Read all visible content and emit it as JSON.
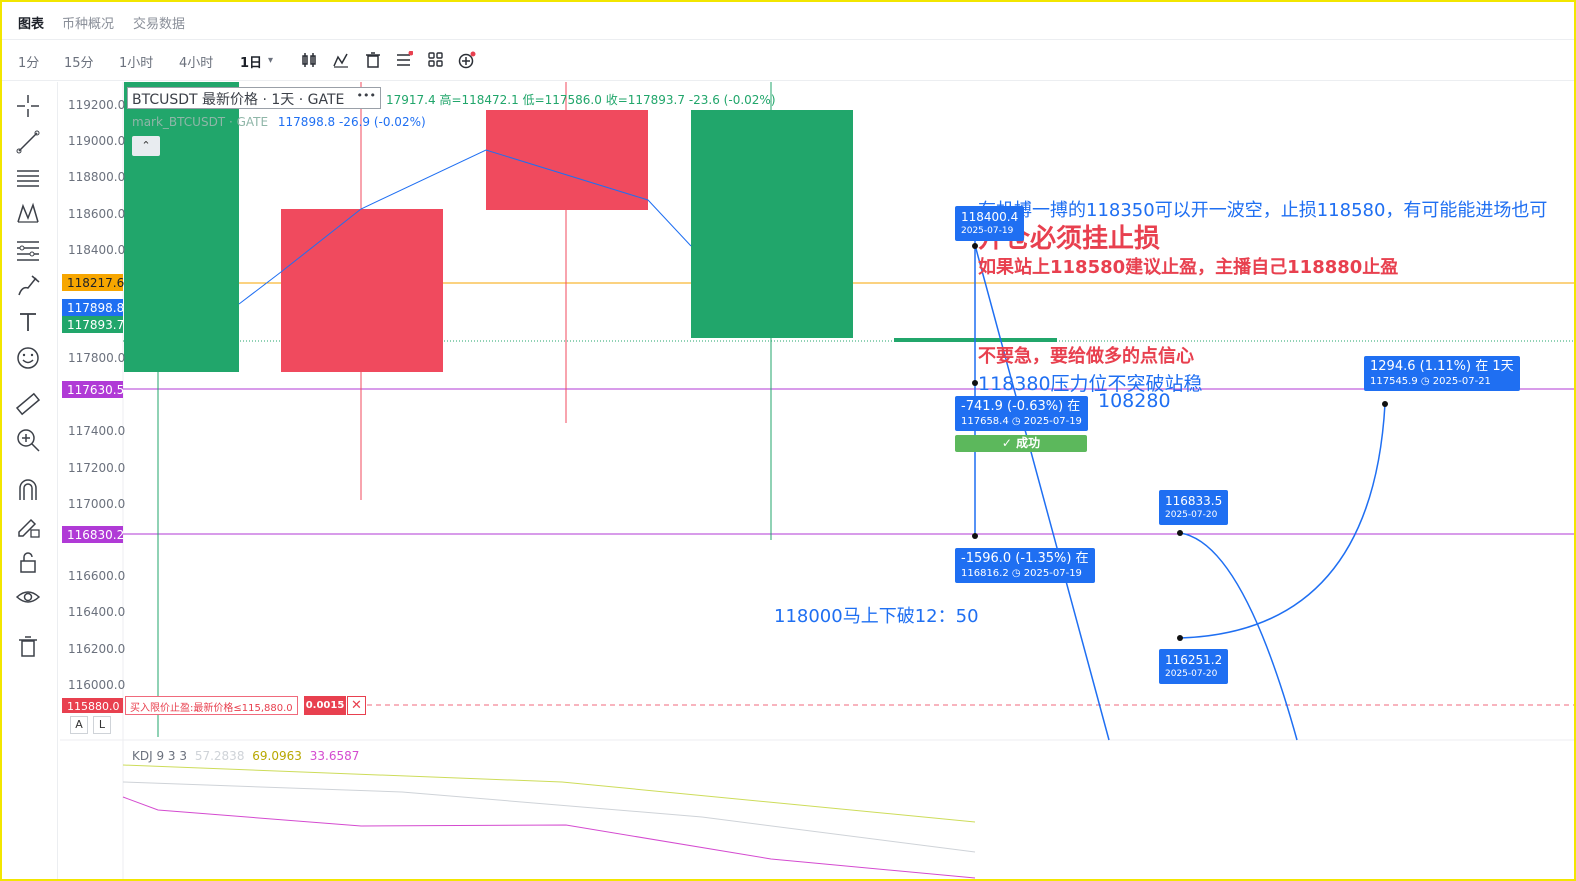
{
  "tabs": [
    {
      "label": "图表",
      "active": true
    },
    {
      "label": "币种概况",
      "active": false
    },
    {
      "label": "交易数据",
      "active": false
    }
  ],
  "timeframes": [
    {
      "label": "1分",
      "active": false
    },
    {
      "label": "15分",
      "active": false
    },
    {
      "label": "1小时",
      "active": false
    },
    {
      "label": "4小时",
      "active": false
    },
    {
      "label": "1日",
      "active": true
    }
  ],
  "timeframe_dropdown_icon": "▾",
  "toolbar_icons": [
    "candle-type-icon",
    "indicator-icon",
    "delete-icon",
    "list-icon",
    "grid-icon",
    "add-icon"
  ],
  "sidebar_icons": [
    "crosshair-icon",
    "trend-line-icon",
    "horizontal-lines-icon",
    "pattern-icon",
    "fib-icon",
    "brush-icon",
    "text-icon",
    "emoji-icon",
    "ruler-icon",
    "zoom-in-icon",
    "magnet-icon",
    "lock-drawing-icon",
    "lock-icon",
    "eye-icon",
    "trash-icon"
  ],
  "legend": {
    "title": "BTCUSDT 最新价格 · 1天 · GATE",
    "more": "•••",
    "values": "17917.4  高=118472.1  低=117586.0  收=117893.7  -23.6 (-0.02%)",
    "mark_label": "mark_BTCUSDT · GATE",
    "mark_values": "117898.8  -26.9 (-0.02%)",
    "collapse": "⌃"
  },
  "price_axis": {
    "ticks": [
      "119200.0",
      "119000.0",
      "118800.0",
      "118600.0",
      "118400.0",
      "117800.0",
      "117400.0",
      "117200.0",
      "117000.0",
      "116600.0",
      "116400.0",
      "116200.0",
      "116000.0"
    ],
    "highlighted": [
      {
        "text": "118217.6",
        "color": "#f7a600",
        "text_color": "#1d2129"
      },
      {
        "text": "117898.8",
        "color": "#1f6ff2",
        "text_color": "#ffffff"
      },
      {
        "text": "117893.7",
        "color": "#21a66b",
        "text_color": "#ffffff"
      },
      {
        "text": "117630.5",
        "color": "#b03ad6",
        "text_color": "#ffffff"
      },
      {
        "text": "116830.2",
        "color": "#b03ad6",
        "text_color": "#ffffff"
      },
      {
        "text": "115880.0",
        "color": "#e8404f",
        "text_color": "#ffffff"
      }
    ]
  },
  "annotations": {
    "line1": "有机搏一搏的118350可以开一波空，止损118580，有可能能进场也可",
    "line2": "开仓必须挂止损",
    "line3": "如果站上118580建议止盈，主播自己118880止盈",
    "line4": "不要急，要给做多的点信心",
    "line5": "118380压力位不突破站稳",
    "line6": "108280",
    "line7": "118000马上下破12：50"
  },
  "price_labels": [
    {
      "big": "118400.4",
      "small": "2025-07-19"
    },
    {
      "big": "-741.9 (-0.63%) 在",
      "small": "117658.4 ◷ 2025-07-19"
    },
    {
      "big": "-1596.0 (-1.35%) 在",
      "small": "116816.2 ◷ 2025-07-19"
    },
    {
      "big": "1294.6 (1.11%) 在 1天",
      "small": "117545.9 ◷ 2025-07-21"
    },
    {
      "big": "116833.5",
      "small": "2025-07-20"
    },
    {
      "big": "116251.2",
      "small": "2025-07-20"
    }
  ],
  "success_label": "✓ 成功",
  "order": {
    "label": "买入限价止盈:最新价格≤115,880.0",
    "qty": "0.0015",
    "close": "✕"
  },
  "al_buttons": [
    "A",
    "L"
  ],
  "kdj": {
    "label": "KDJ 9 3 3",
    "k": "57.2838",
    "d": "69.0963",
    "j": "33.6587",
    "k_color": "#cfd3d8",
    "d_color": "#cddc5a",
    "j_color": "#d44bd0"
  },
  "colors": {
    "up": "#21a66b",
    "down": "#f04a5e",
    "accent": "#1f6ff2",
    "alert": "#e8404f"
  }
}
